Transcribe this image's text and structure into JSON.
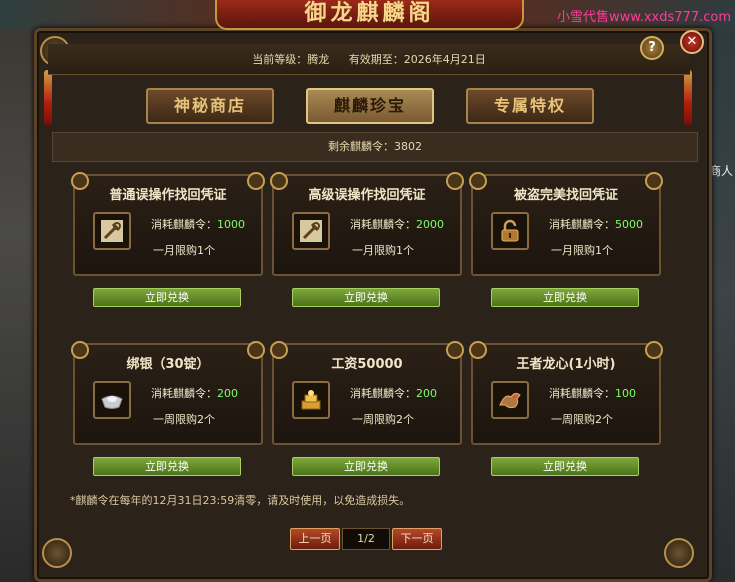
{
  "window": {
    "title": "御龙麒麟阁"
  },
  "watermark": "小雪代售www.xxds777.com",
  "side_label": "商人",
  "header": {
    "level_label": "当前等级：腾龙",
    "expiry_label": "有效期至：2026年4月21日"
  },
  "buttons": {
    "help": "?",
    "close": "✕"
  },
  "tabs": [
    {
      "label": "神秘商店",
      "active": false
    },
    {
      "label": "麒麟珍宝",
      "active": true
    },
    {
      "label": "专属特权",
      "active": false
    }
  ],
  "counter": "剩余麒麟令：3802",
  "cost_label": "消耗麒麟令：",
  "exchange_label": "立即兑换",
  "items": [
    {
      "title": "普通误操作找回凭证",
      "cost": "1000",
      "limit": "一月限购1个",
      "icon": "wrench-icon"
    },
    {
      "title": "高级误操作找回凭证",
      "cost": "2000",
      "limit": "一月限购1个",
      "icon": "wrench-icon"
    },
    {
      "title": "被盗完美找回凭证",
      "cost": "5000",
      "limit": "一月限购1个",
      "icon": "lock-icon"
    },
    {
      "title": "绑银（30锭）",
      "cost": "200",
      "limit": "一周限购2个",
      "icon": "silver-ingot-icon"
    },
    {
      "title": "工资50000",
      "cost": "200",
      "limit": "一周限购2个",
      "icon": "gold-pile-icon"
    },
    {
      "title": "王者龙心(1小时)",
      "cost": "100",
      "limit": "一周限购2个",
      "icon": "dragon-icon"
    }
  ],
  "note": "*麒麟令在每年的12月31日23:59清零，请及时使用，以免造成损失。",
  "pager": {
    "prev": "上一页",
    "page": "1/2",
    "next": "下一页"
  },
  "colors": {
    "accent": "#7cff6a",
    "button_green": "#6a9a30",
    "frame": "#5b4326",
    "pager_red": "#9a3018"
  }
}
